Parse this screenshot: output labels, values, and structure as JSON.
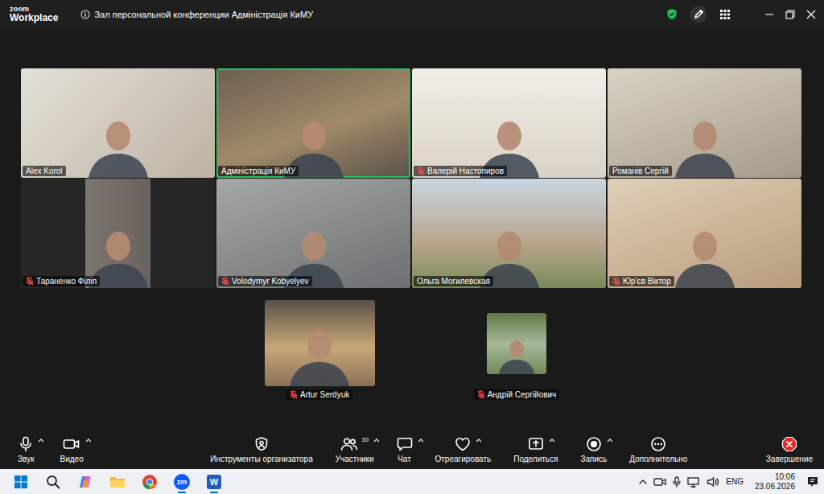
{
  "window": {
    "title": "Зал персональной конференции Адміністрація КиМУ",
    "app_logo": [
      "zoom",
      "Workplace"
    ],
    "controls": [
      {
        "kind": "shield"
      },
      {
        "kind": "pencil"
      },
      {
        "kind": "apps"
      },
      {
        "kind": "minimize"
      },
      {
        "kind": "restore"
      },
      {
        "kind": "close"
      }
    ]
  },
  "gallery": {
    "rows": [
      [
        {
          "name": "Alex Korol",
          "muted": false,
          "speaking": false
        },
        {
          "name": "Адміністрація КиМУ",
          "muted": false,
          "speaking": true
        },
        {
          "name": "Валерій Настопиров",
          "muted": true,
          "speaking": false
        },
        {
          "name": "Романів Сергій",
          "muted": false,
          "speaking": false
        }
      ],
      [
        {
          "name": "Тараненко Філіп",
          "muted": true,
          "speaking": false
        },
        {
          "name": "Volodymyr Kobyelyev",
          "muted": true,
          "speaking": false
        },
        {
          "name": "Ольга Могилевская",
          "muted": false,
          "speaking": false
        },
        {
          "name": "Юр'єв Віктор",
          "muted": true,
          "speaking": false
        }
      ],
      [
        {
          "name": "Artur Serdyuk",
          "muted": true,
          "speaking": false
        },
        {
          "name": "Андрій Сергійович",
          "muted": true,
          "speaking": false
        }
      ]
    ]
  },
  "toolbar": {
    "items": [
      {
        "kind": "mic",
        "label": "Звук",
        "caret": true
      },
      {
        "kind": "video",
        "label": "Видео",
        "caret": true
      },
      {
        "kind": "host",
        "label": "Инструменты организатора",
        "caret": false
      },
      {
        "kind": "participants",
        "label": "Участники",
        "count": "10",
        "caret": true
      },
      {
        "kind": "chat",
        "label": "Чат",
        "caret": true
      },
      {
        "kind": "react",
        "label": "Отреагировать",
        "caret": true
      },
      {
        "kind": "share",
        "label": "Поделиться",
        "caret": true
      },
      {
        "kind": "record",
        "label": "Запись",
        "caret": true
      },
      {
        "kind": "more",
        "label": "Дополнительно",
        "caret": false
      },
      {
        "kind": "end",
        "label": "Завершение",
        "caret": false
      }
    ]
  },
  "taskbar": {
    "apps": [
      {
        "kind": "start",
        "running": false
      },
      {
        "kind": "search",
        "running": false
      },
      {
        "kind": "copilot",
        "running": false
      },
      {
        "kind": "explorer",
        "running": false
      },
      {
        "kind": "chrome",
        "running": false
      },
      {
        "kind": "zoom",
        "label": "zm",
        "running": true
      },
      {
        "kind": "word",
        "label": "W",
        "running": true
      }
    ],
    "tray": [
      {
        "kind": "chevron"
      },
      {
        "kind": "camera"
      },
      {
        "kind": "mic"
      },
      {
        "kind": "network"
      },
      {
        "kind": "volume"
      }
    ],
    "language": "ENG",
    "time": "10:06",
    "date": "23.06.2026"
  }
}
